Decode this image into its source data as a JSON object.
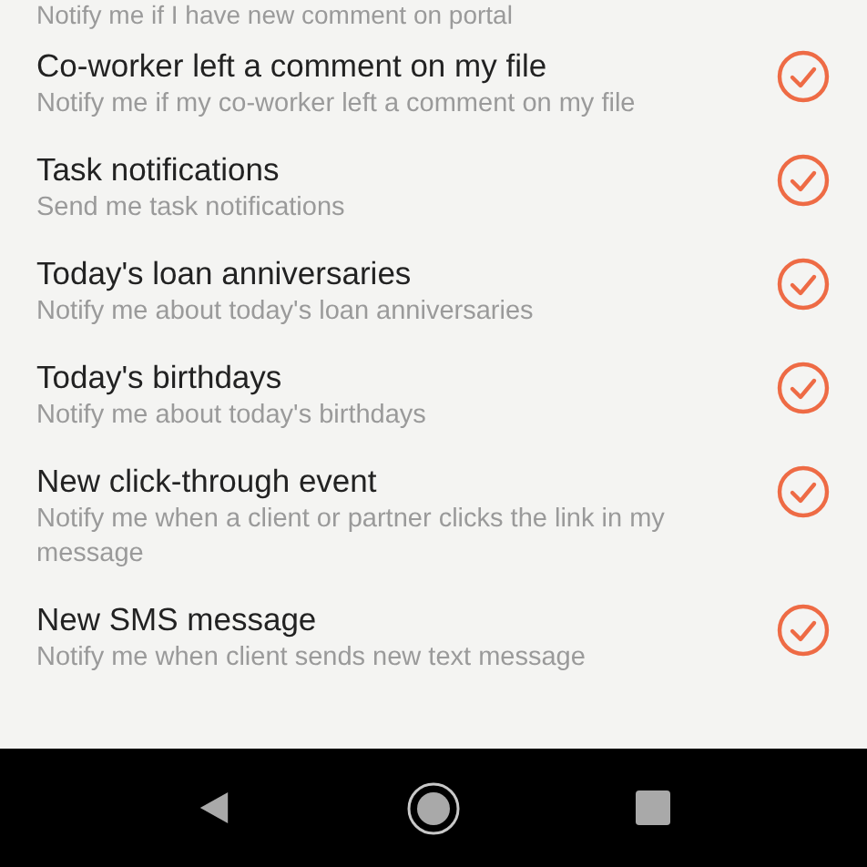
{
  "top_subtitle": "Notify me if I have new comment on portal",
  "settings": [
    {
      "title": "Co-worker left a comment on my file",
      "subtitle": "Notify me if my co-worker left a comment on my file",
      "checked": true
    },
    {
      "title": "Task notifications",
      "subtitle": "Send me task notifications",
      "checked": true
    },
    {
      "title": "Today's loan anniversaries",
      "subtitle": "Notify me about today's loan anniversaries",
      "checked": true
    },
    {
      "title": "Today's birthdays",
      "subtitle": "Notify me about today's birthdays",
      "checked": true
    },
    {
      "title": "New click-through event",
      "subtitle": "Notify me when a client or partner clicks the link in my message",
      "checked": true
    },
    {
      "title": "New SMS message",
      "subtitle": "Notify me when client sends new text message",
      "checked": true
    }
  ]
}
